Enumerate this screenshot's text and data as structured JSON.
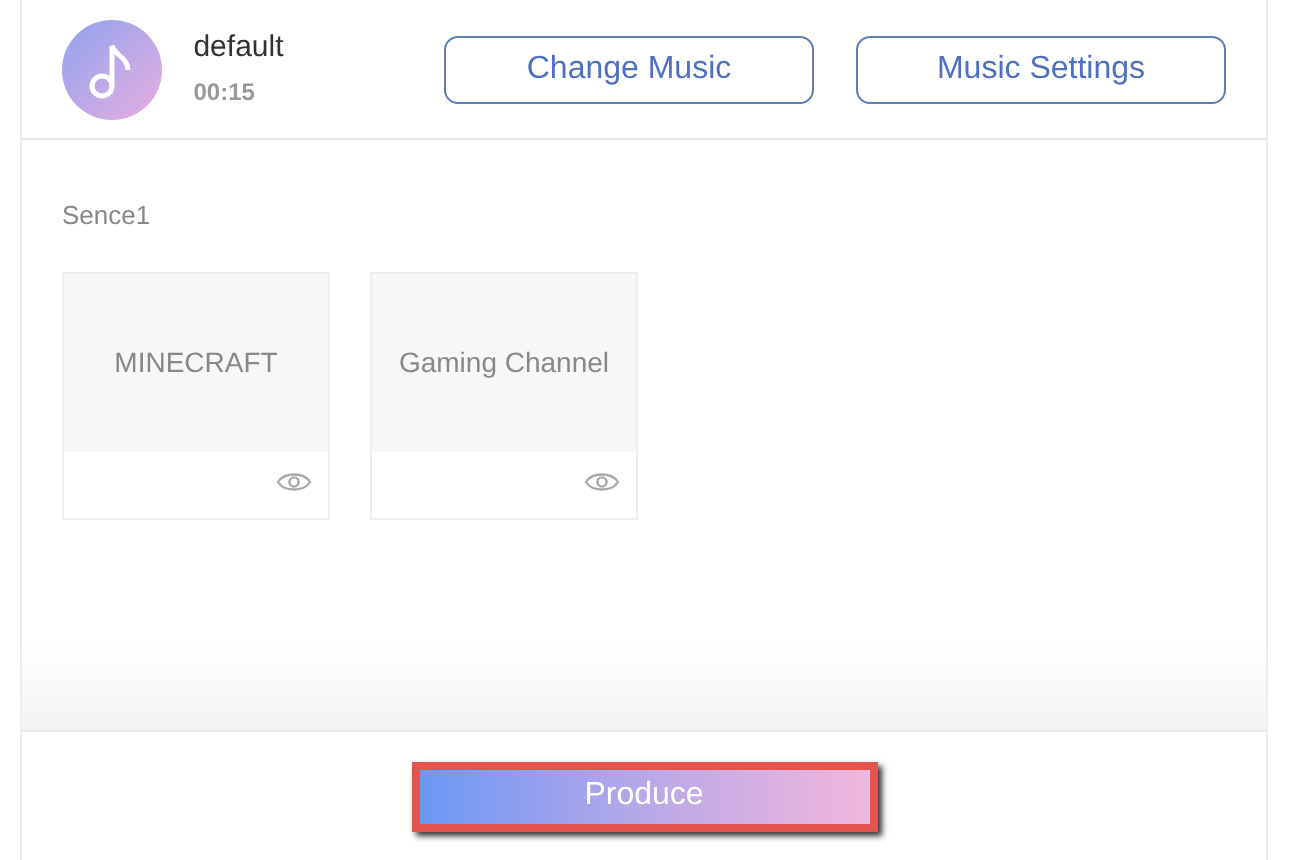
{
  "music": {
    "title": "default",
    "duration": "00:15"
  },
  "buttons": [
    "Change Music",
    "Music Settings"
  ],
  "scene": {
    "title": "Sence1",
    "cards": [
      {
        "label": "MINECRAFT"
      },
      {
        "label": "Gaming Channel"
      }
    ]
  },
  "footer": {
    "button": "Produce",
    "highlighted": true
  }
}
